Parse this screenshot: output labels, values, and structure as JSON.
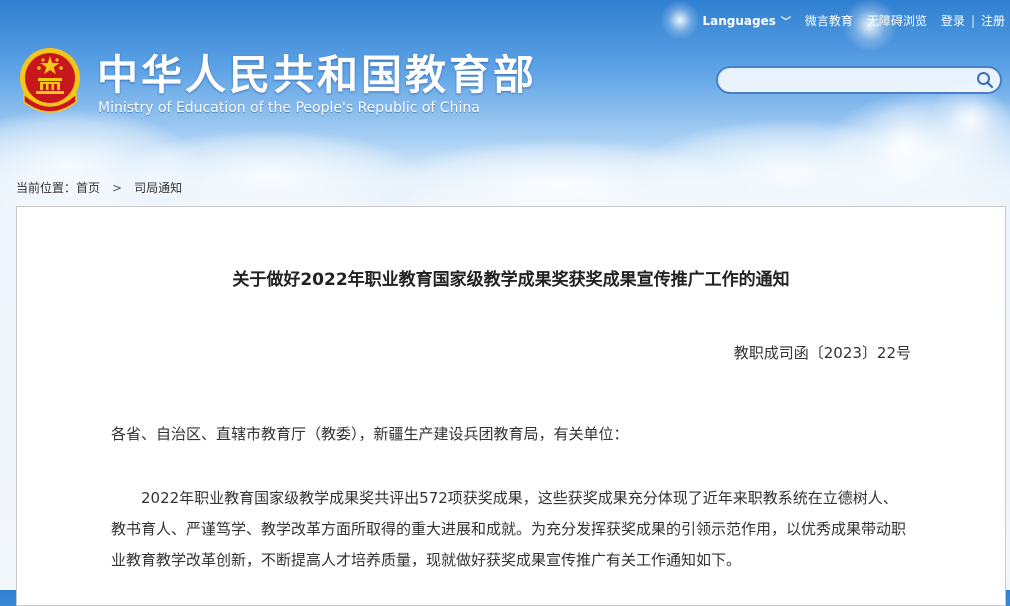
{
  "header": {
    "title": "中华人民共和国教育部",
    "subtitle": "Ministry of Education of the People's Republic of China",
    "nav": {
      "languages": "Languages",
      "weiyan": "微言教育",
      "accessibility": "无障碍浏览",
      "login": "登录",
      "separator": "|",
      "register": "注册"
    },
    "search": {
      "placeholder": "",
      "value": ""
    }
  },
  "breadcrumb": {
    "prefix": "当前位置：",
    "home": "首页",
    "separator": ">",
    "current": "司局通知"
  },
  "article": {
    "title": "关于做好2022年职业教育国家级教学成果奖获奖成果宣传推广工作的通知",
    "doc_number": "教职成司函〔2023〕22号",
    "salutation": "各省、自治区、直辖市教育厅（教委），新疆生产建设兵团教育局，有关单位：",
    "paragraph1": "2022年职业教育国家级教学成果奖共评出572项获奖成果，这些获奖成果充分体现了近年来职教系统在立德树人、教书育人、严谨笃学、教学改革方面所取得的重大进展和成就。为充分发挥获奖成果的引领示范作用，以优秀成果带动职业教育教学改革创新，不断提高人才培养质量，现就做好获奖成果宣传推广有关工作通知如下。"
  },
  "colors": {
    "header_blue": "#2f7fd0",
    "emblem_red": "#c8161d",
    "emblem_gold": "#f5c518",
    "search_border": "#4a7ec8"
  }
}
